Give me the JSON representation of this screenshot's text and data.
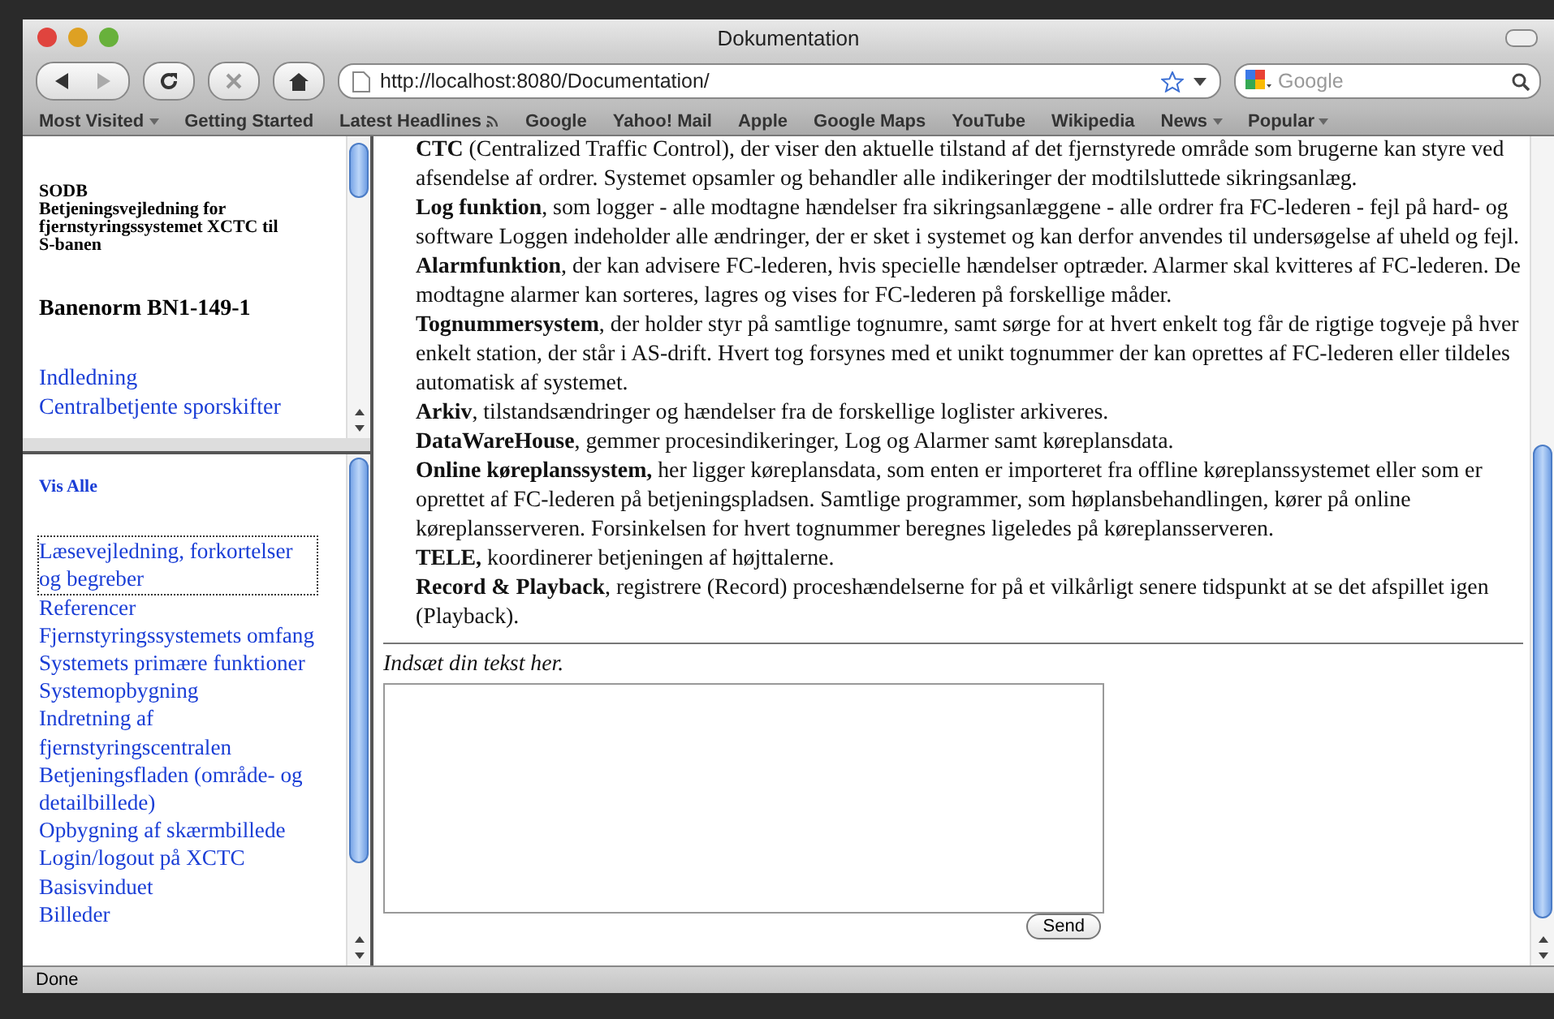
{
  "window": {
    "title": "Dokumentation"
  },
  "toolbar": {
    "url": "http://localhost:8080/Documentation/",
    "search_placeholder": "Google"
  },
  "bookmarks": [
    {
      "label": "Most Visited",
      "kind": "menu"
    },
    {
      "label": "Getting Started",
      "kind": "link"
    },
    {
      "label": "Latest Headlines",
      "kind": "feed"
    },
    {
      "label": "Google",
      "kind": "link"
    },
    {
      "label": "Yahoo! Mail",
      "kind": "link"
    },
    {
      "label": "Apple",
      "kind": "link"
    },
    {
      "label": "Google Maps",
      "kind": "link"
    },
    {
      "label": "YouTube",
      "kind": "link"
    },
    {
      "label": "Wikipedia",
      "kind": "link"
    },
    {
      "label": "News",
      "kind": "menu"
    },
    {
      "label": "Popular",
      "kind": "menu"
    }
  ],
  "sidebar_top": {
    "heading": "SODB",
    "subtitle": "Betjeningsvejledning for fjernstyringssystemet XCTC til S-banen",
    "norm": "Banenorm BN1-149-1",
    "links": [
      "Indledning",
      "Centralbetjente sporskifter"
    ]
  },
  "sidebar_bottom": {
    "show_all": "Vis Alle",
    "links": [
      {
        "label": "Læsevejledning, forkortelser og begreber",
        "focused": true
      },
      {
        "label": "Referencer",
        "focused": false
      },
      {
        "label": "Fjernstyringssystemets omfang",
        "focused": false
      },
      {
        "label": "Systemets primære funktioner",
        "focused": false
      },
      {
        "label": "Systemopbygning",
        "focused": false
      },
      {
        "label": "Indretning af fjernstyringscentralen",
        "focused": false
      },
      {
        "label": "Betjeningsfladen (område- og detailbillede)",
        "focused": false
      },
      {
        "label": "Opbygning af skærmbillede",
        "focused": false
      },
      {
        "label": "Login/logout på XCTC",
        "focused": false
      },
      {
        "label": "Basisvinduet",
        "focused": false
      },
      {
        "label": "Billeder",
        "focused": false
      }
    ]
  },
  "content": {
    "paragraphs": [
      "**CTC** (Centralized Traffic Control), der viser den aktuelle tilstand af det fjernstyrede område som brugerne kan styre ved afsendelse af ordrer. Systemet opsamler og behandler alle indikeringer der modtilsluttede sikringsanlæg.",
      "**Log funktion**, som logger - alle modtagne hændelser fra sikringsanlæggene - alle ordrer fra FC-lederen - fejl på hard- og software Loggen indeholder alle ændringer, der er sket i systemet og kan derfor anvendes til undersøgelse af uheld og fejl.",
      "**Alarmfunktion**, der kan advisere FC-lederen, hvis specielle hændelser optræder. Alarmer skal kvitteres af FC-lederen. De modtagne alarmer kan sorteres, lagres og vises for FC-lederen på forskellige måder.",
      "**Tognummersystem**, der holder styr på samtlige tognumre, samt sørge for at hvert enkelt tog får de rigtige togveje på hver enkelt station, der står i AS-drift. Hvert tog forsynes med et unikt tognummer der kan oprettes af FC-lederen eller tildeles automatisk af systemet.",
      "**Arkiv**, tilstandsændringer og hændelser fra de forskellige loglister arkiveres.",
      "**DataWareHouse**, gemmer procesindikeringer, Log og Alarmer samt køreplansdata.",
      "**Online køreplanssystem,** her ligger køreplansdata, som enten er importeret fra offline køreplanssystemet eller som er oprettet af FC-lederen på betjeningspladsen. Samtlige programmer, som høplansbehandlingen, kører på online køreplansserveren. Forsinkelsen for hvert tognummer beregnes ligeledes på køreplansserveren.",
      "**TELE,** koordinerer betjeningen af højttalerne.",
      "**Record & Playback**, registrere (Record) proceshændelserne for på et vilkårligt senere tidspunkt at se det afspillet igen (Playback)."
    ],
    "comment_label": "Indsæt din tekst her.",
    "send_button": "Send"
  },
  "status_bar": "Done"
}
